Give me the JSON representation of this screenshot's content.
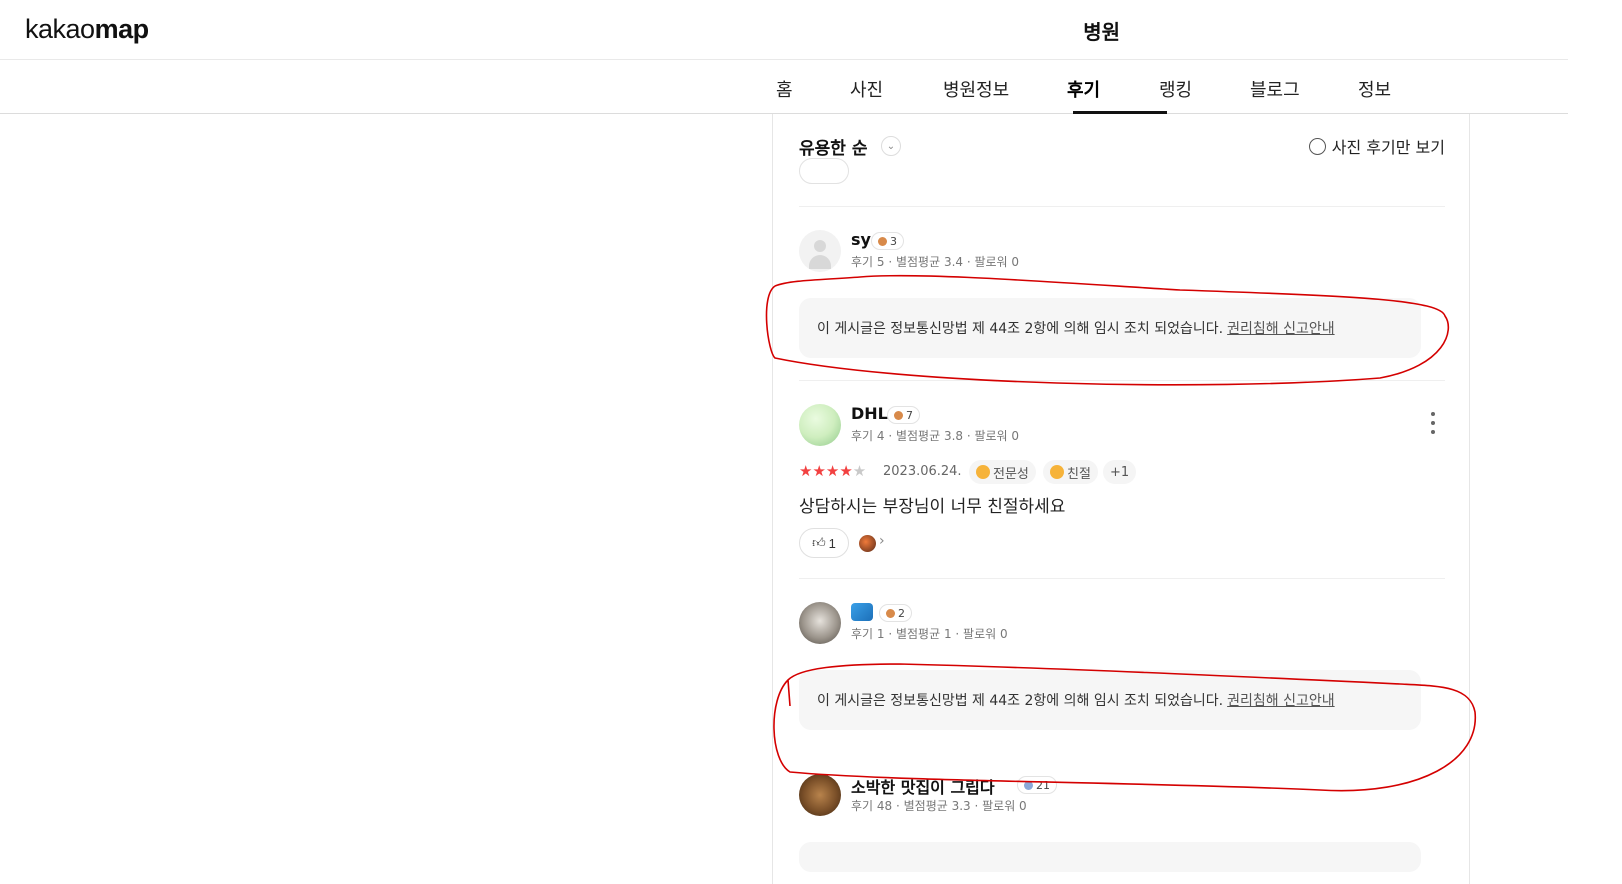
{
  "app": {
    "logo_light": "kakao",
    "logo_bold": "map",
    "place_title": "병원"
  },
  "tabs": [
    {
      "label": "홈",
      "active": false
    },
    {
      "label": "사진",
      "active": false
    },
    {
      "label": "병원정보",
      "active": false
    },
    {
      "label": "후기",
      "active": true
    },
    {
      "label": "랭킹",
      "active": false
    },
    {
      "label": "블로그",
      "active": false
    },
    {
      "label": "정보",
      "active": false
    }
  ],
  "toolbar": {
    "sort_label": "유용한 순",
    "photo_only_label": "사진 후기만 보기",
    "photo_only_checked": false
  },
  "reviews": [
    {
      "nickname": "sy",
      "level": "3",
      "meta": "후기 5 · 별점평균 3.4 · 팔로워 0",
      "blocked": true,
      "notice": "이 게시글은 정보통신망법 제 44조 2항에 의해 임시 조치 되었습니다.",
      "notice_link": "권리침해 신고안내"
    },
    {
      "nickname": "DHL",
      "level": "7",
      "meta": "후기 4 · 별점평균 3.8 · 팔로워 0",
      "rating": 4,
      "date": "2023.06.24.",
      "tags": [
        "전문성",
        "친절"
      ],
      "more_tags": "+1",
      "text": "상담하시는 부장님이 너무 친절하세요",
      "likes": "1"
    },
    {
      "nickname": "",
      "level": "2",
      "meta": "후기 1 · 별점평균 1 · 팔로워 0",
      "blocked": true,
      "notice": "이 게시글은 정보통신망법 제 44조 2항에 의해 임시 조치 되었습니다.",
      "notice_link": "권리침해 신고안내"
    },
    {
      "nickname": "소박한 맛집이 그립다",
      "level": "21",
      "meta": "후기 48 · 별점평균 3.3 · 팔로워 0"
    }
  ],
  "colors": {
    "star": "#f24141",
    "annotation": "#d40000",
    "accent": "#111111"
  },
  "icons": {
    "sort": "chevron-down-icon",
    "more": "more-vertical-icon",
    "like": "thumbs-up-icon"
  }
}
